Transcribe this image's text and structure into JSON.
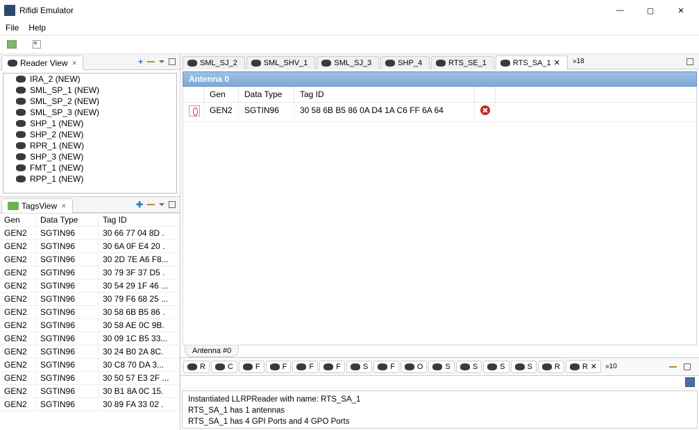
{
  "window": {
    "title": "Rifidi Emulator"
  },
  "menu": {
    "file": "File",
    "help": "Help"
  },
  "reader_view": {
    "title": "Reader View",
    "items": [
      "IRA_2 (NEW)",
      "SML_SP_1 (NEW)",
      "SML_SP_2 (NEW)",
      "SML_SP_3 (NEW)",
      "SHP_1 (NEW)",
      "SHP_2 (NEW)",
      "RPR_1 (NEW)",
      "SHP_3 (NEW)",
      "FMT_1 (NEW)",
      "RPP_1 (NEW)"
    ]
  },
  "tags_view": {
    "title": "TagsView",
    "columns": {
      "gen": "Gen",
      "datatype": "Data Type",
      "tagid": "Tag ID"
    },
    "rows": [
      {
        "gen": "GEN2",
        "datatype": "SGTIN96",
        "tagid": "30 66 77 04 8D ."
      },
      {
        "gen": "GEN2",
        "datatype": "SGTIN96",
        "tagid": "30 6A 0F E4 20 ."
      },
      {
        "gen": "GEN2",
        "datatype": "SGTIN96",
        "tagid": "30 2D 7E A6 F8..."
      },
      {
        "gen": "GEN2",
        "datatype": "SGTIN96",
        "tagid": "30 79 3F 37 D5 ."
      },
      {
        "gen": "GEN2",
        "datatype": "SGTIN96",
        "tagid": "30 54 29 1F 46 ..."
      },
      {
        "gen": "GEN2",
        "datatype": "SGTIN96",
        "tagid": "30 79 F6 68 25 ..."
      },
      {
        "gen": "GEN2",
        "datatype": "SGTIN96",
        "tagid": "30 58 6B B5 86 ."
      },
      {
        "gen": "GEN2",
        "datatype": "SGTIN96",
        "tagid": "30 58 AE 0C 9B."
      },
      {
        "gen": "GEN2",
        "datatype": "SGTIN96",
        "tagid": "30 09 1C B5 33..."
      },
      {
        "gen": "GEN2",
        "datatype": "SGTIN96",
        "tagid": "30 24 B0 2A 8C."
      },
      {
        "gen": "GEN2",
        "datatype": "SGTIN96",
        "tagid": "30 C8 70 DA 3..."
      },
      {
        "gen": "GEN2",
        "datatype": "SGTIN96",
        "tagid": "30 50 57 E3 2F ..."
      },
      {
        "gen": "GEN2",
        "datatype": "SGTIN96",
        "tagid": "30 B1 8A 0C 15."
      },
      {
        "gen": "GEN2",
        "datatype": "SGTIN96",
        "tagid": "30 89 FA 33 02 ."
      }
    ]
  },
  "editor_tabs": {
    "tabs": [
      {
        "label": "SML_SJ_2",
        "active": false
      },
      {
        "label": "SML_SHV_1",
        "active": false
      },
      {
        "label": "SML_SJ_3",
        "active": false
      },
      {
        "label": "SHP_4",
        "active": false
      },
      {
        "label": "RTS_SE_1",
        "active": false
      },
      {
        "label": "RTS_SA_1",
        "active": true
      }
    ],
    "overflow": "»18"
  },
  "antenna": {
    "header": "Antenna 0",
    "columns": {
      "gen": "Gen",
      "datatype": "Data Type",
      "tagid": "Tag ID"
    },
    "rows": [
      {
        "gen": "GEN2",
        "datatype": "SGTIN96",
        "tagid": "30 58 6B B5 86 0A D4 1A C6 FF 6A 64"
      }
    ],
    "bottom_tab": "Antenna #0"
  },
  "ports": {
    "tabs": [
      "R",
      "C",
      "F",
      "F",
      "F",
      "F",
      "S",
      "F",
      "O",
      "S",
      "S",
      "S",
      "S",
      "R",
      "R"
    ],
    "active_index": 14,
    "overflow": "»10"
  },
  "console": {
    "lines": [
      "Instantiated LLRPReader with name: RTS_SA_1",
      "RTS_SA_1 has 1 antennas",
      "RTS_SA_1 has 4 GPI Ports and 4 GPO Ports"
    ]
  }
}
